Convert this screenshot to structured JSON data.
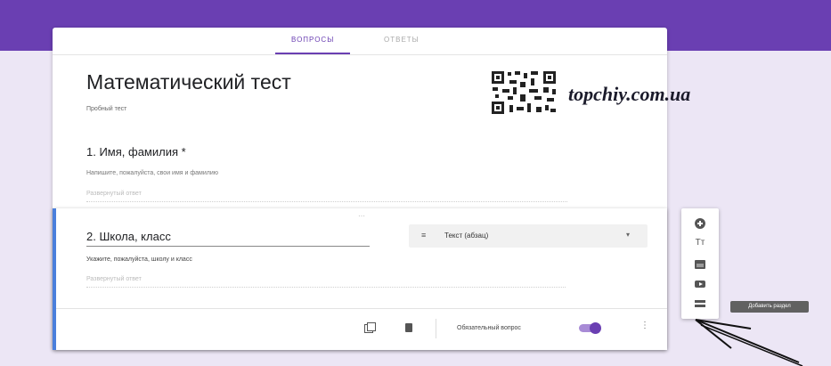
{
  "tabs": [
    {
      "label": "ВОПРОСЫ",
      "active": true
    },
    {
      "label": "ОТВЕТЫ",
      "active": false
    }
  ],
  "form": {
    "title": "Математический тест",
    "description": "Пробный тест"
  },
  "questions": [
    {
      "title": "1. Имя, фамилия *",
      "description": "Напишите, пожалуйста, свои имя и фамилию",
      "answer_placeholder": "Развернутый ответ"
    },
    {
      "title": "2. Школа, класс",
      "description": "Укажите, пожалуйста, школу и класс",
      "answer_placeholder": "Развернутый ответ",
      "type": "Текст (абзац)",
      "required_label": "Обязательный вопрос",
      "required": true
    }
  ],
  "toolbar": {
    "items": [
      {
        "icon": "add-question-icon"
      },
      {
        "icon": "title-icon",
        "glyph": "Tт"
      },
      {
        "icon": "image-icon"
      },
      {
        "icon": "video-icon"
      },
      {
        "icon": "section-icon"
      }
    ],
    "tooltip": "Добавить раздел"
  },
  "watermark": "topchiy.com.ua",
  "colors": {
    "accent": "#6a3fb2",
    "background": "#ece6f5",
    "active_border": "#4a7fdc"
  }
}
